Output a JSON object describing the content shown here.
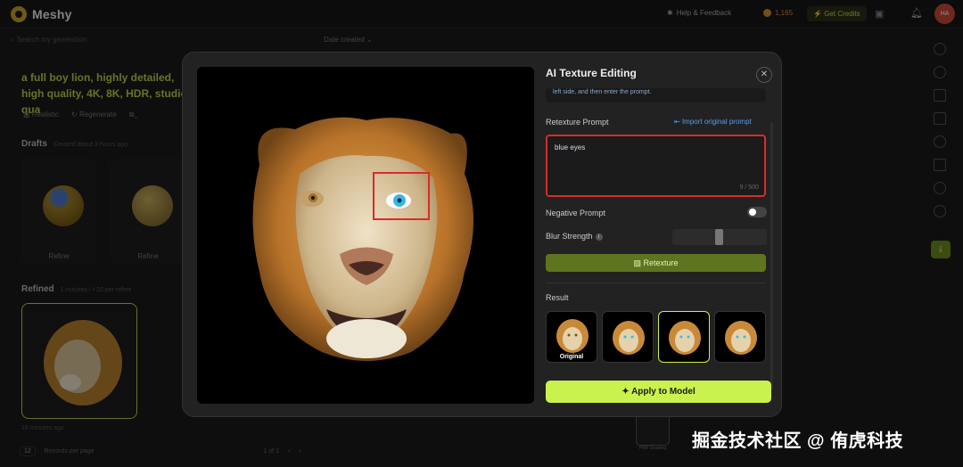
{
  "app": {
    "logo": "Meshy",
    "help_label": "Help & Feedback",
    "credits_count": "1,165",
    "get_credits_label": "Get Credits",
    "avatar_initials": "HA"
  },
  "left_panel": {
    "search_placeholder": "Search my generation",
    "sort_label": "Date created",
    "prompt_title": "a full boy lion, highly detailed, high quality, 4K, 8K, HDR, studio qua",
    "tool_realistic": "Realistic",
    "tool_regenerate": "Regenerate",
    "drafts_label": "Drafts",
    "drafts_sub": "Created about 3 hours ago",
    "refine_label_1": "Refine",
    "refine_label_2": "Refine",
    "refined_label": "Refined",
    "refined_sub": "1 minutes / • 20 per refine",
    "refined_time": "18 minutes ago",
    "page_size": "12",
    "records_label": "Records per page",
    "page_info": "1 of 1"
  },
  "modal": {
    "title": "AI Texture Editing",
    "hint_text": "left side, and then enter the prompt.",
    "retexture_prompt_label": "Retexture Prompt",
    "import_link": "Import original prompt",
    "prompt_value": "blue eyes",
    "prompt_count": "9 / 500",
    "negative_prompt_label": "Negative Prompt",
    "blur_strength_label": "Blur Strength",
    "retexture_button": "Retexture",
    "result_label": "Result",
    "results": [
      {
        "label": "Original",
        "selected": false
      },
      {
        "label": "",
        "selected": false
      },
      {
        "label": "",
        "selected": true
      },
      {
        "label": "",
        "selected": false
      }
    ],
    "apply_button": "Apply to Model",
    "negative_prompt_enabled": false
  },
  "bottom_thumb_label": "PBR Shading",
  "watermark": "掘金技术社区 @ 侑虎科技",
  "colors": {
    "accent_green": "#c9f24f",
    "highlight_red": "#d92b2b",
    "title_green": "#b9d24a",
    "eye_blue": "#3ab8e6"
  }
}
